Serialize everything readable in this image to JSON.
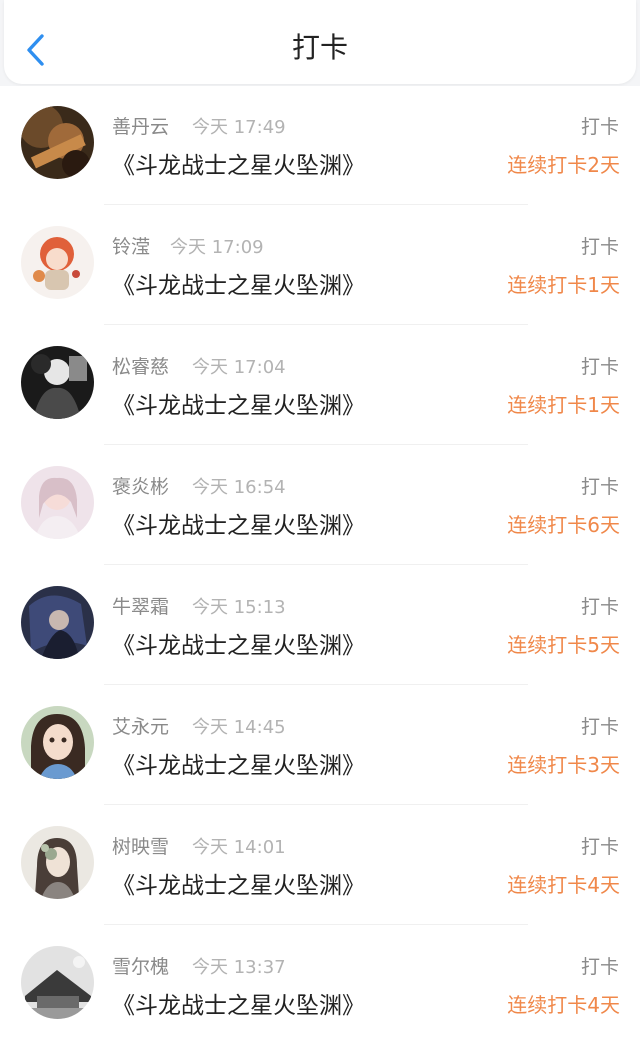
{
  "header": {
    "title": "打卡",
    "back_icon": "chevron-left-icon",
    "accent_color": "#2f8ff0"
  },
  "streak_color": "#f0884a",
  "items": [
    {
      "name": "善丹云",
      "time": "今天 17:49",
      "book": "《斗龙战士之星火坠渊》",
      "action": "打卡",
      "streak": "连续打卡2天",
      "avatar": "avatar-1"
    },
    {
      "name": "铃滢",
      "time": "今天 17:09",
      "book": "《斗龙战士之星火坠渊》",
      "action": "打卡",
      "streak": "连续打卡1天",
      "avatar": "avatar-2"
    },
    {
      "name": "松睿慈",
      "time": "今天 17:04",
      "book": "《斗龙战士之星火坠渊》",
      "action": "打卡",
      "streak": "连续打卡1天",
      "avatar": "avatar-3"
    },
    {
      "name": "褒炎彬",
      "time": "今天 16:54",
      "book": "《斗龙战士之星火坠渊》",
      "action": "打卡",
      "streak": "连续打卡6天",
      "avatar": "avatar-4"
    },
    {
      "name": "牛翠霜",
      "time": "今天 15:13",
      "book": "《斗龙战士之星火坠渊》",
      "action": "打卡",
      "streak": "连续打卡5天",
      "avatar": "avatar-5"
    },
    {
      "name": "艾永元",
      "time": "今天 14:45",
      "book": "《斗龙战士之星火坠渊》",
      "action": "打卡",
      "streak": "连续打卡3天",
      "avatar": "avatar-6"
    },
    {
      "name": "树映雪",
      "time": "今天 14:01",
      "book": "《斗龙战士之星火坠渊》",
      "action": "打卡",
      "streak": "连续打卡4天",
      "avatar": "avatar-7"
    },
    {
      "name": "雪尔槐",
      "time": "今天 13:37",
      "book": "《斗龙战士之星火坠渊》",
      "action": "打卡",
      "streak": "连续打卡4天",
      "avatar": "avatar-8"
    }
  ]
}
